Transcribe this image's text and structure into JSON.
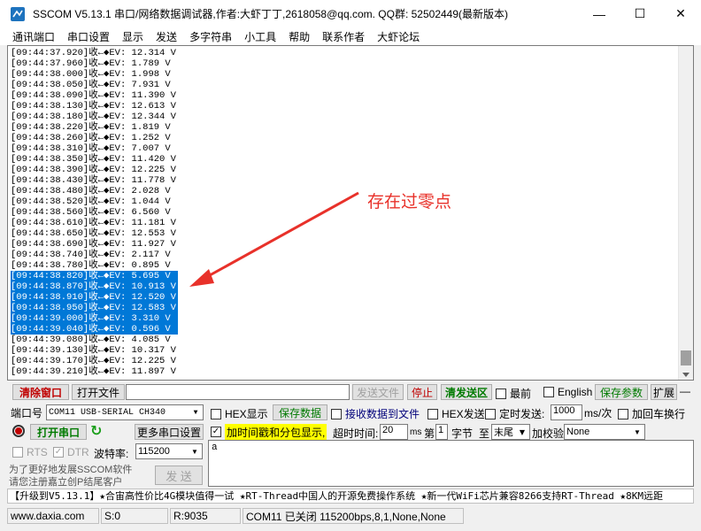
{
  "window": {
    "title": "SSCOM V5.13.1 串口/网络数据调试器,作者:大虾丁丁,2618058@qq.com. QQ群: 52502449(最新版本)",
    "minimize": "—",
    "maximize": "☐",
    "close": "✕"
  },
  "menu": [
    "通讯端口",
    "串口设置",
    "显示",
    "发送",
    "多字符串",
    "小工具",
    "帮助",
    "联系作者",
    "大虾论坛"
  ],
  "log": {
    "lines": [
      {
        "time": "[09:44:37.920]",
        "arrow": "收←◆",
        "value": "EV: 12.314 V",
        "selected": false
      },
      {
        "time": "[09:44:37.960]",
        "arrow": "收←◆",
        "value": "EV: 1.789 V",
        "selected": false
      },
      {
        "time": "[09:44:38.000]",
        "arrow": "收←◆",
        "value": "EV: 1.998 V",
        "selected": false
      },
      {
        "time": "[09:44:38.050]",
        "arrow": "收←◆",
        "value": "EV: 7.931 V",
        "selected": false
      },
      {
        "time": "[09:44:38.090]",
        "arrow": "收←◆",
        "value": "EV: 11.390 V",
        "selected": false
      },
      {
        "time": "[09:44:38.130]",
        "arrow": "收←◆",
        "value": "EV: 12.613 V",
        "selected": false
      },
      {
        "time": "[09:44:38.180]",
        "arrow": "收←◆",
        "value": "EV: 12.344 V",
        "selected": false
      },
      {
        "time": "[09:44:38.220]",
        "arrow": "收←◆",
        "value": "EV: 1.819 V",
        "selected": false
      },
      {
        "time": "[09:44:38.260]",
        "arrow": "收←◆",
        "value": "EV: 1.252 V",
        "selected": false
      },
      {
        "time": "[09:44:38.310]",
        "arrow": "收←◆",
        "value": "EV: 7.007 V",
        "selected": false
      },
      {
        "time": "[09:44:38.350]",
        "arrow": "收←◆",
        "value": "EV: 11.420 V",
        "selected": false
      },
      {
        "time": "[09:44:38.390]",
        "arrow": "收←◆",
        "value": "EV: 12.225 V",
        "selected": false
      },
      {
        "time": "[09:44:38.430]",
        "arrow": "收←◆",
        "value": "EV: 11.778 V",
        "selected": false
      },
      {
        "time": "[09:44:38.480]",
        "arrow": "收←◆",
        "value": "EV: 2.028 V",
        "selected": false
      },
      {
        "time": "[09:44:38.520]",
        "arrow": "收←◆",
        "value": "EV: 1.044 V",
        "selected": false
      },
      {
        "time": "[09:44:38.560]",
        "arrow": "收←◆",
        "value": "EV: 6.560 V",
        "selected": false
      },
      {
        "time": "[09:44:38.610]",
        "arrow": "收←◆",
        "value": "EV: 11.181 V",
        "selected": false
      },
      {
        "time": "[09:44:38.650]",
        "arrow": "收←◆",
        "value": "EV: 12.553 V",
        "selected": false
      },
      {
        "time": "[09:44:38.690]",
        "arrow": "收←◆",
        "value": "EV: 11.927 V",
        "selected": false
      },
      {
        "time": "[09:44:38.740]",
        "arrow": "收←◆",
        "value": "EV: 2.117 V",
        "selected": false
      },
      {
        "time": "[09:44:38.780]",
        "arrow": "收←◆",
        "value": "EV: 0.895 V",
        "selected": false
      },
      {
        "time": "[09:44:38.820]",
        "arrow": "收←◆",
        "value": "EV: 5.695 V",
        "selected": true
      },
      {
        "time": "[09:44:38.870]",
        "arrow": "收←◆",
        "value": "EV: 10.913 V",
        "selected": true
      },
      {
        "time": "[09:44:38.910]",
        "arrow": "收←◆",
        "value": "EV: 12.520 V",
        "selected": true
      },
      {
        "time": "[09:44:38.950]",
        "arrow": "收←◆",
        "value": "EV: 12.583 V",
        "selected": true
      },
      {
        "time": "[09:44:39.000]",
        "arrow": "收←◆",
        "value": "EV: 3.310 V",
        "selected": true
      },
      {
        "time": "[09:44:39.040]",
        "arrow": "收←◆",
        "value": "EV: 0.596 V",
        "selected": true
      },
      {
        "time": "[09:44:39.080]",
        "arrow": "收←◆",
        "value": "EV: 4.085 V",
        "selected": false
      },
      {
        "time": "[09:44:39.130]",
        "arrow": "收←◆",
        "value": "EV: 10.317 V",
        "selected": false
      },
      {
        "time": "[09:44:39.170]",
        "arrow": "收←◆",
        "value": "EV: 12.225 V",
        "selected": false
      },
      {
        "time": "[09:44:39.210]",
        "arrow": "收←◆",
        "value": "EV: 11.897 V",
        "selected": false
      }
    ]
  },
  "annotation": {
    "text": "存在过零点",
    "color": "#e8312a"
  },
  "toolbar": {
    "clear_window": "清除窗口",
    "open_file": "打开文件",
    "send_file": "发送文件",
    "stop": "停止",
    "clear_send_area": "清发送区",
    "last_label": "最前",
    "english_label": "English",
    "save_params": "保存参数",
    "expand": "扩展",
    "collapse": "—"
  },
  "port": {
    "label": "端口号",
    "selected": "COM11 USB-SERIAL CH340",
    "hex_display": "HEX显示",
    "save_data": "保存数据",
    "recv_to_file": "接收数据到文件",
    "hex_send": "HEX发送",
    "timed_send": "定时发送:",
    "interval": "1000",
    "interval_unit": "ms/次",
    "add_newline": "加回车换行",
    "open_port": "打开串口",
    "more_settings": "更多串口设置",
    "timestamp_label": "加时间戳和分包显示,",
    "timeout_label": "超时时间:",
    "timeout_value": "20",
    "timeout_unit": "ms",
    "byte_prefix": "第",
    "byte_index": "1",
    "byte_unit": "字节",
    "to_label": "至",
    "to_value": "末尾",
    "checksum_label": "加校验",
    "checksum_value": "None",
    "rts": "RTS",
    "dtr": "DTR",
    "baud_label": "波特率:",
    "baud_value": "115200",
    "promo_line1": "为了更好地发展SSCOM软件",
    "promo_line2": "请您注册嘉立创P结尾客户",
    "send_button": "发 送",
    "send_text": "a"
  },
  "ticker": "【升级到V5.13.1】★合宙高性价比4G模块值得一试 ★RT-Thread中国人的开源免费操作系统 ★新一代WiFi芯片兼容8266支持RT-Thread ★8KM远距",
  "status": {
    "site": "www.daxia.com",
    "sent": "S:0",
    "received": "R:9035",
    "port_state": "COM11 已关闭  115200bps,8,1,None,None"
  },
  "colors": {
    "selection": "#0078d7",
    "timestamp_highlight": "#ffff00",
    "open_button_indicator": "#c00000"
  }
}
